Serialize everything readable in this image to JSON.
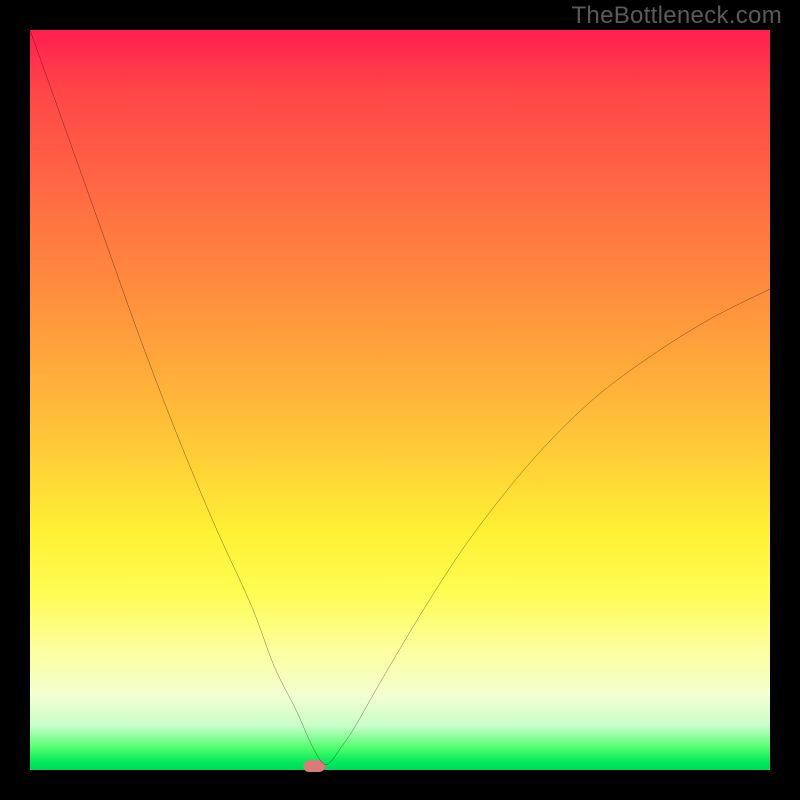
{
  "watermark": "TheBottleneck.com",
  "chart_data": {
    "type": "line",
    "title": "",
    "xlabel": "",
    "ylabel": "",
    "xlim": [
      0,
      100
    ],
    "ylim": [
      0,
      100
    ],
    "grid": false,
    "legend": false,
    "background": "rainbow-vertical-gradient",
    "series": [
      {
        "name": "bottleneck-curve",
        "x": [
          0,
          5,
          10,
          15,
          20,
          25,
          30,
          33,
          36,
          38,
          39.5,
          40.5,
          42,
          44,
          48,
          54,
          60,
          68,
          76,
          84,
          92,
          100
        ],
        "y": [
          100,
          86,
          72,
          58,
          45,
          33,
          22,
          14,
          8,
          3.5,
          1,
          1,
          3,
          6,
          13,
          23,
          32,
          42,
          50,
          56,
          61,
          65
        ]
      }
    ],
    "annotations": [
      {
        "type": "marker",
        "shape": "rounded-rect",
        "x": 40,
        "y": 0.5,
        "color": "#d87b79"
      }
    ]
  },
  "marker": {
    "left_pct": 38.4,
    "bottom_pct": 0.0
  }
}
